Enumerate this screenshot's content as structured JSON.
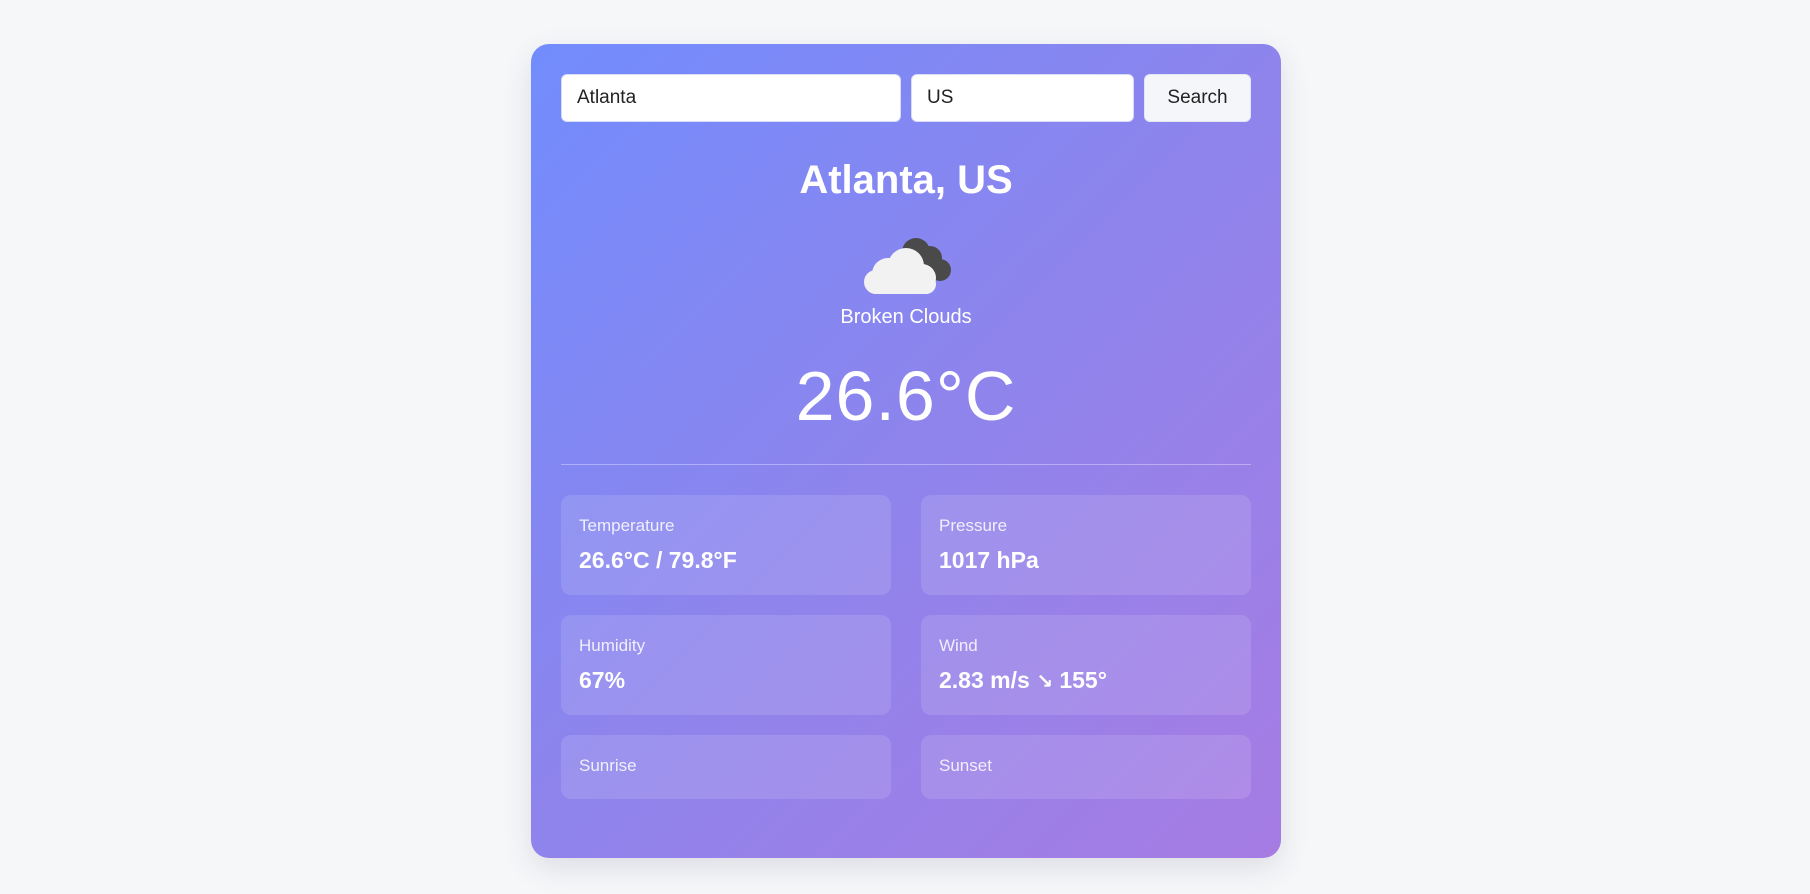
{
  "search": {
    "city_value": "Atlanta",
    "country_value": "US",
    "button_label": "Search"
  },
  "weather": {
    "location": "Atlanta, US",
    "icon": "broken-clouds-icon",
    "description": "Broken Clouds",
    "temperature": "26.6°C"
  },
  "stats": {
    "temperature": {
      "label": "Temperature",
      "value": "26.6°C / 79.8°F"
    },
    "pressure": {
      "label": "Pressure",
      "value": "1017 hPa"
    },
    "humidity": {
      "label": "Humidity",
      "value": "67%"
    },
    "wind": {
      "label": "Wind",
      "speed": "2.83 m/s",
      "arrow": "↘",
      "direction": "155°"
    },
    "sunrise": {
      "label": "Sunrise"
    },
    "sunset": {
      "label": "Sunset"
    }
  },
  "colors": {
    "page_background": "#f6f7f9",
    "card_gradient_start": "#728cfd",
    "card_gradient_end": "#a67ce3"
  }
}
